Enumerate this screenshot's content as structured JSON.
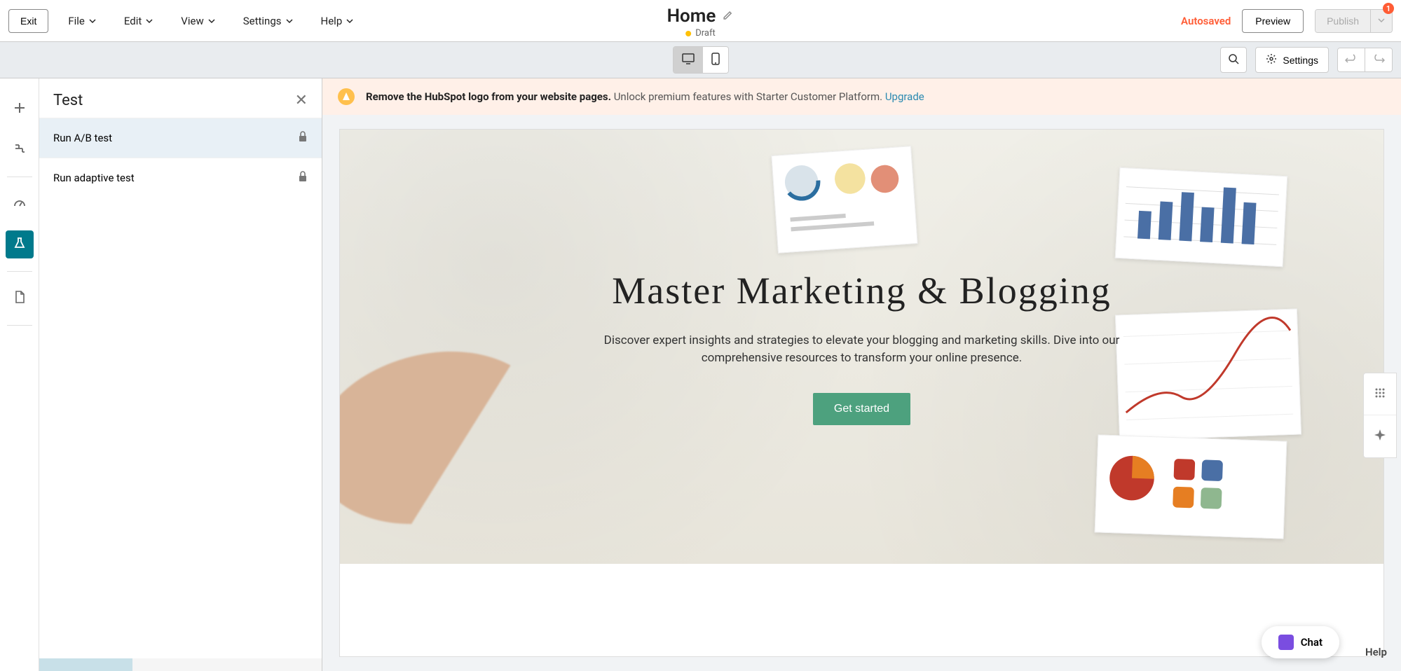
{
  "toolbar": {
    "exit": "Exit",
    "menu": {
      "file": "File",
      "edit": "Edit",
      "view": "View",
      "settings": "Settings",
      "help": "Help"
    },
    "page_title": "Home",
    "status": "Draft",
    "autosaved": "Autosaved",
    "preview": "Preview",
    "publish": "Publish",
    "notification_count": "1"
  },
  "second_toolbar": {
    "settings": "Settings"
  },
  "left_panel": {
    "title": "Test",
    "options": [
      {
        "label": "Run A/B test"
      },
      {
        "label": "Run adaptive test"
      }
    ]
  },
  "banner": {
    "bold": "Remove the HubSpot logo from your website pages.",
    "text": "Unlock premium features with Starter Customer Platform.",
    "link": "Upgrade"
  },
  "hero": {
    "title": "Master Marketing & Blogging",
    "subtitle": "Discover expert insights and strategies to elevate your blogging and marketing skills. Dive into our comprehensive resources to transform your online presence.",
    "cta": "Get started"
  },
  "bottom": {
    "chat": "Chat",
    "help": "Help"
  }
}
